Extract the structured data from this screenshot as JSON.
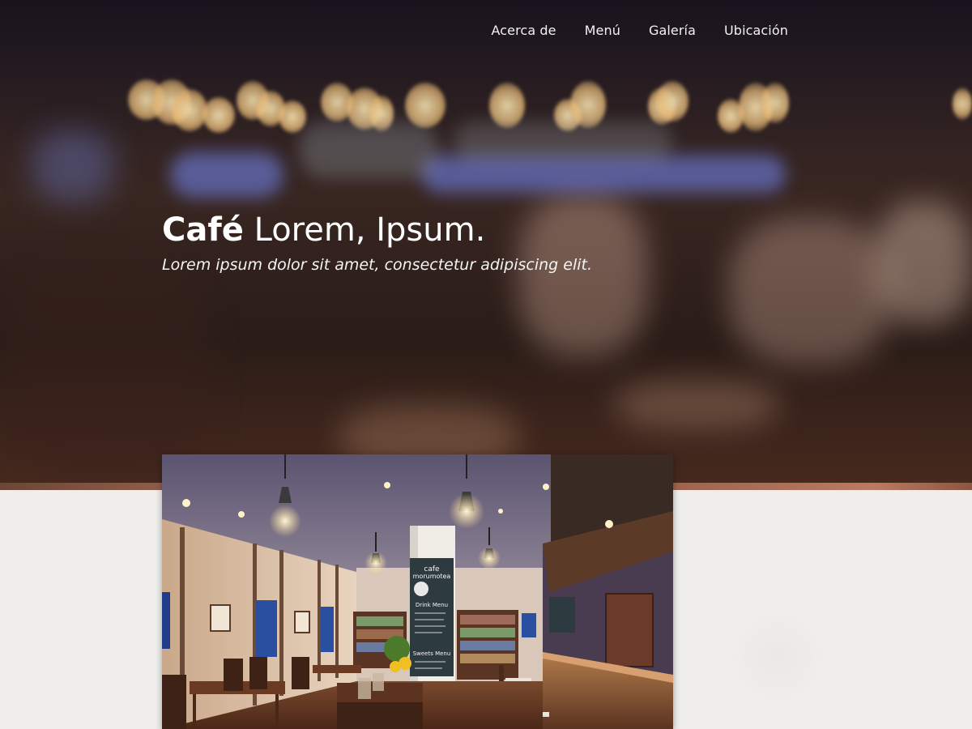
{
  "nav": {
    "items": [
      {
        "label": "Acerca de"
      },
      {
        "label": "Menú"
      },
      {
        "label": "Galería"
      },
      {
        "label": "Ubicación"
      }
    ]
  },
  "hero": {
    "title_bold": "Café",
    "title_rest": " Lorem, Ipsum.",
    "subtitle": "Lorem ipsum dolor sit amet, consectetur adipiscing elit."
  },
  "illustration": {
    "sign_name_line1": "cafe",
    "sign_name_line2": "morumotea",
    "sign_drink_menu": "Drink Menu",
    "sign_sweets_menu": "Sweets Menu"
  },
  "colors": {
    "hero_dark": "#2b1f22",
    "paper": "#efeeec",
    "text_light": "#ffffff"
  }
}
